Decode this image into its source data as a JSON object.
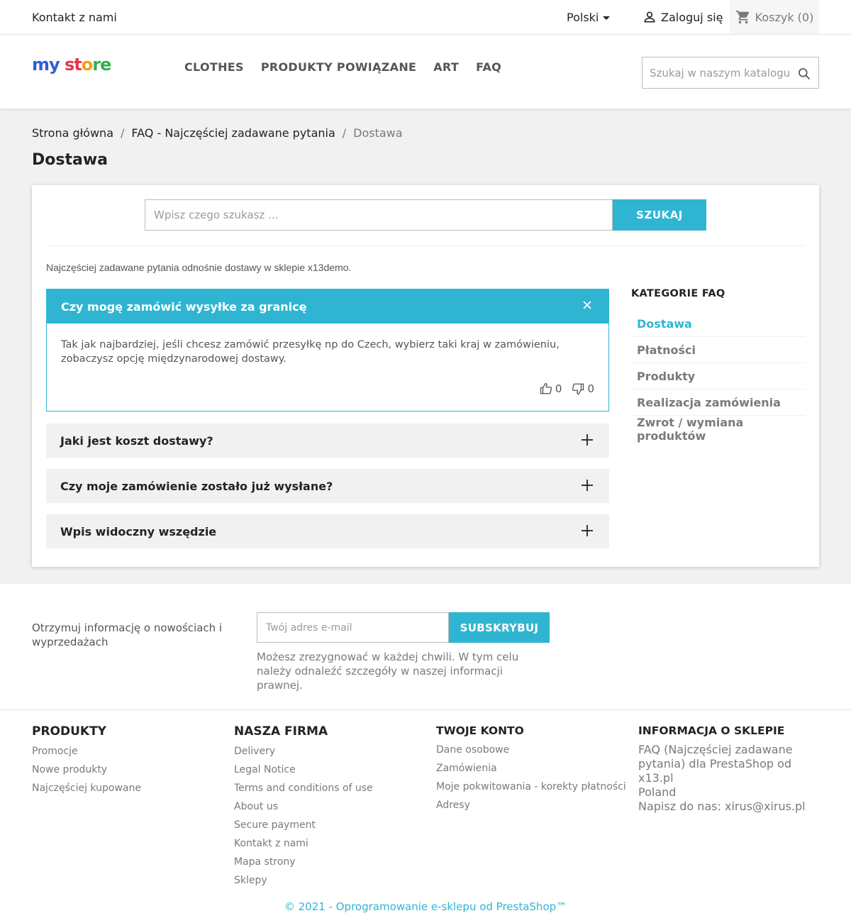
{
  "topbar": {
    "contact": "Kontakt z nami",
    "language": "Polski",
    "login": "Zaloguj się",
    "cart": "Koszyk (0)"
  },
  "header": {
    "logo": {
      "part1": "my",
      "part2": "st",
      "part3": "o",
      "part4": "re"
    },
    "nav": [
      "CLOTHES",
      "PRODUKTY POWIĄZANE",
      "ART",
      "FAQ"
    ],
    "search_placeholder": "Szukaj w naszym katalogu"
  },
  "breadcrumb": [
    "Strona główna",
    "FAQ - Najczęściej zadawane pytania",
    "Dostawa"
  ],
  "page_title": "Dostawa",
  "faq": {
    "search_placeholder": "Wpisz czego szukasz ...",
    "search_button": "SZUKAJ",
    "intro": "Najczęściej zadawane pytania odnośnie dostawy w sklepie x13demo.",
    "open_item": {
      "question": "Czy mogę zamówić wysyłke za granicę",
      "answer": "Tak jak najbardziej, jeśli chcesz zamówić przesyłkę np do Czech, wybierz taki kraj w zamówieniu, zobaczysz opcję międzynarodowej dostawy.",
      "upvotes": "0",
      "downvotes": "0"
    },
    "closed_items": [
      "Jaki jest koszt dostawy?",
      "Czy moje zamówienie zostało już wysłane?",
      "Wpis widoczny wszędzie"
    ]
  },
  "categories": {
    "title": "KATEGORIE FAQ",
    "items": [
      "Dostawa",
      "Płatności",
      "Produkty",
      "Realizacja zamówienia",
      "Zwrot / wymiana produktów"
    ]
  },
  "newsletter": {
    "text": "Otrzymuj informację o nowościach i wyprzedażach",
    "placeholder": "Twój adres e-mail",
    "button": "SUBSKRYBUJ",
    "note": "Możesz zrezygnować w każdej chwili. W tym celu należy odnaleźć szczegóły w naszej informacji prawnej."
  },
  "footer": {
    "products": {
      "title": "PRODUKTY",
      "links": [
        "Promocje",
        "Nowe produkty",
        "Najczęściej kupowane"
      ]
    },
    "company": {
      "title": "NASZA FIRMA",
      "links": [
        "Delivery",
        "Legal Notice",
        "Terms and conditions of use",
        "About us",
        "Secure payment",
        "Kontakt z nami",
        "Mapa strony",
        "Sklepy"
      ]
    },
    "account": {
      "title": "TWOJE KONTO",
      "links": [
        "Dane osobowe",
        "Zamówienia",
        "Moje pokwitowania - korekty płatności",
        "Adresy"
      ]
    },
    "store_info": {
      "title": "INFORMACJA O SKLEPIE",
      "line1": "FAQ (Najczęściej zadawane pytania) dla PrestaShop od x13.pl",
      "line2": "Poland",
      "line3": "Napisz do nas: xirus@xirus.pl"
    },
    "copyright": "© 2021 - Oprogramowanie e-sklepu od PrestaShop™"
  },
  "colors": {
    "accent": "#2fb5d2",
    "text": "#232323",
    "muted": "#7a7a7a",
    "bg": "#f1f1f1"
  }
}
